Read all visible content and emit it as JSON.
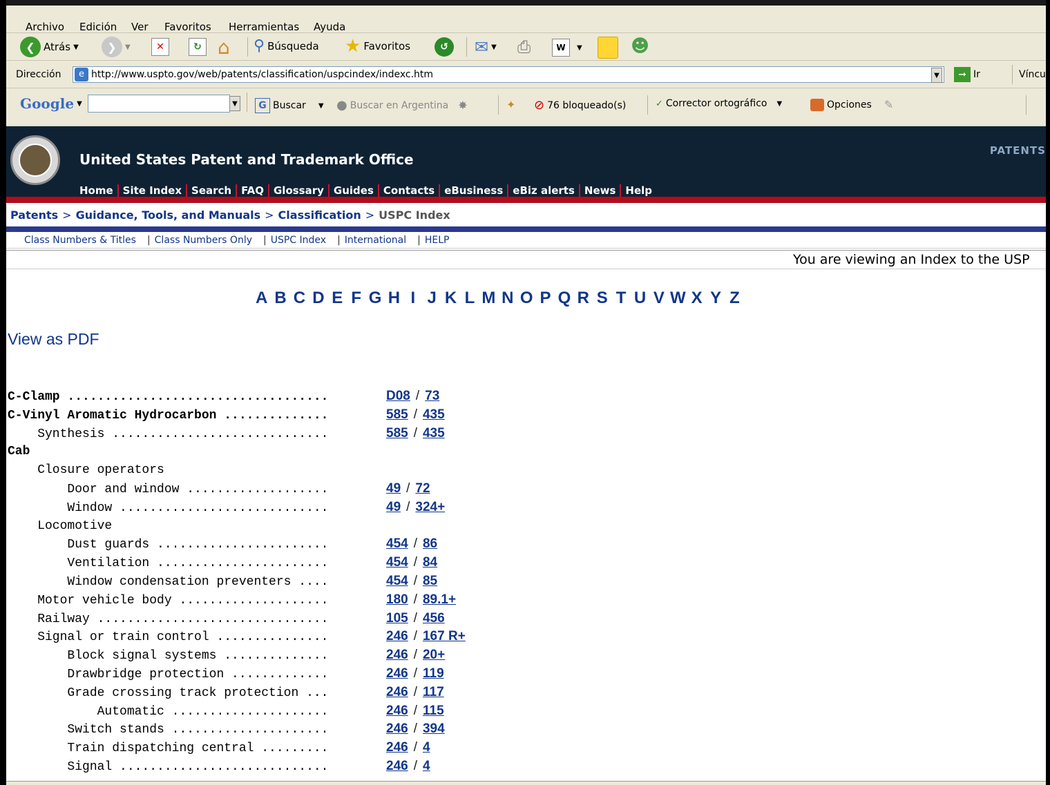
{
  "browser": {
    "menu": [
      "Archivo",
      "Edición",
      "Ver",
      "Favoritos",
      "Herramientas",
      "Ayuda"
    ],
    "toolbar": {
      "back": "Atrás",
      "search": "Búsqueda",
      "favorites": "Favoritos"
    },
    "address_label": "Dirección",
    "url": "http://www.uspto.gov/web/patents/classification/uspcindex/indexc.htm",
    "go_label": "Ir",
    "links_label": "Víncu",
    "google": {
      "search": "Buscar",
      "search_ar": "Buscar en Argentina",
      "blocked": "76 bloqueado(s)",
      "spell": "Corrector ortográfico",
      "options": "Opciones"
    }
  },
  "site": {
    "title": "United States Patent and Trademark Office",
    "corner": "PATENTS",
    "nav": [
      "Home",
      "Site Index",
      "Search",
      "FAQ",
      "Glossary",
      "Guides",
      "Contacts",
      "eBusiness",
      "eBiz alerts",
      "News",
      "Help"
    ],
    "breadcrumb": [
      "Patents",
      "Guidance, Tools, and Manuals",
      "Classification"
    ],
    "breadcrumb_current": "USPC Index",
    "subnav": [
      "Class Numbers & Titles",
      "Class Numbers Only",
      "USPC Index",
      "International",
      "HELP"
    ],
    "viewing": "You are viewing an Index to the USP"
  },
  "alphabet": [
    "A",
    "B",
    "C",
    "D",
    "E",
    "F",
    "G",
    "H",
    "I",
    "J",
    "K",
    "L",
    "M",
    "N",
    "O",
    "P",
    "Q",
    "R",
    "S",
    "T",
    "U",
    "V",
    "W",
    "X",
    "Y",
    "Z"
  ],
  "view_pdf": "View as PDF",
  "index_rows": [
    {
      "text": "C-Clamp",
      "level": 0,
      "bold": true,
      "cls": "D08",
      "sub": "73"
    },
    {
      "text": "C-Vinyl Aromatic Hydrocarbon",
      "level": 0,
      "bold": true,
      "cls": "585",
      "sub": "435"
    },
    {
      "text": "Synthesis",
      "level": 1,
      "bold": false,
      "cls": "585",
      "sub": "435"
    },
    {
      "text": "Cab",
      "level": 0,
      "bold": true,
      "cls": "",
      "sub": ""
    },
    {
      "text": "Closure operators",
      "level": 1,
      "bold": false,
      "cls": "",
      "sub": ""
    },
    {
      "text": "Door and window",
      "level": 2,
      "bold": false,
      "cls": "49",
      "sub": "72"
    },
    {
      "text": "Window",
      "level": 2,
      "bold": false,
      "cls": "49",
      "sub": "324+"
    },
    {
      "text": "Locomotive",
      "level": 1,
      "bold": false,
      "cls": "",
      "sub": ""
    },
    {
      "text": "Dust guards",
      "level": 2,
      "bold": false,
      "cls": "454",
      "sub": "86"
    },
    {
      "text": "Ventilation",
      "level": 2,
      "bold": false,
      "cls": "454",
      "sub": "84"
    },
    {
      "text": "Window condensation preventers",
      "level": 2,
      "bold": false,
      "cls": "454",
      "sub": "85"
    },
    {
      "text": "Motor vehicle body",
      "level": 1,
      "bold": false,
      "cls": "180",
      "sub": "89.1+"
    },
    {
      "text": "Railway",
      "level": 1,
      "bold": false,
      "cls": "105",
      "sub": "456"
    },
    {
      "text": "Signal or train control",
      "level": 1,
      "bold": false,
      "cls": "246",
      "sub": "167 R+"
    },
    {
      "text": "Block signal systems",
      "level": 2,
      "bold": false,
      "cls": "246",
      "sub": "20+"
    },
    {
      "text": "Drawbridge protection",
      "level": 2,
      "bold": false,
      "cls": "246",
      "sub": "119"
    },
    {
      "text": "Grade crossing track protection",
      "level": 2,
      "bold": false,
      "cls": "246",
      "sub": "117"
    },
    {
      "text": "Automatic",
      "level": 3,
      "bold": false,
      "cls": "246",
      "sub": "115"
    },
    {
      "text": "Switch stands",
      "level": 2,
      "bold": false,
      "cls": "246",
      "sub": "394"
    },
    {
      "text": "Train dispatching central",
      "level": 2,
      "bold": false,
      "cls": "246",
      "sub": "4"
    },
    {
      "text": "Signal",
      "level": 2,
      "bold": false,
      "cls": "246",
      "sub": "4"
    }
  ]
}
